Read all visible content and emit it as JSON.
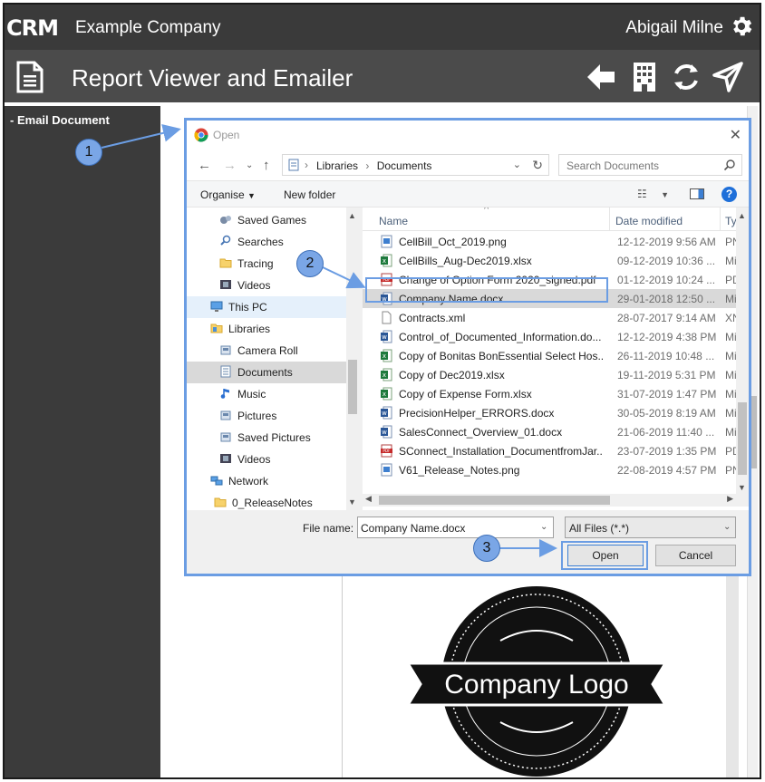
{
  "app": {
    "logo_text": "CRM",
    "company": "Example Company",
    "user": "Abigail Milne",
    "page_title": "Report Viewer and Emailer"
  },
  "sidebar": {
    "items": [
      {
        "label": "Email Document"
      }
    ]
  },
  "dialog": {
    "title": "Open",
    "address_path": [
      "Libraries",
      "Documents"
    ],
    "search_placeholder": "Search Documents",
    "toolbar": {
      "organise": "Organise",
      "new_folder": "New folder"
    },
    "nav_items": [
      {
        "label": "Saved Games",
        "icon": "saved-games-icon"
      },
      {
        "label": "Searches",
        "icon": "search-folder-icon"
      },
      {
        "label": "Tracing",
        "icon": "folder-icon"
      },
      {
        "label": "Videos",
        "icon": "videos-icon"
      },
      {
        "label": "This PC",
        "icon": "computer-icon"
      },
      {
        "label": "Libraries",
        "icon": "libraries-icon"
      },
      {
        "label": "Camera Roll",
        "icon": "library-icon"
      },
      {
        "label": "Documents",
        "icon": "documents-icon",
        "selected": true
      },
      {
        "label": "Music",
        "icon": "music-icon"
      },
      {
        "label": "Pictures",
        "icon": "library-icon"
      },
      {
        "label": "Saved Pictures",
        "icon": "library-icon"
      },
      {
        "label": "Videos",
        "icon": "videos-icon"
      },
      {
        "label": "Network",
        "icon": "network-icon"
      },
      {
        "label": "0_ReleaseNotes",
        "icon": "folder-icon"
      }
    ],
    "columns": {
      "name": "Name",
      "date": "Date modified",
      "type": "Typ"
    },
    "files": [
      {
        "name": "CellBill_Oct_2019.png",
        "date": "12-12-2019 9:56 AM",
        "type": "PN",
        "icon": "image-file-icon"
      },
      {
        "name": "CellBills_Aug-Dec2019.xlsx",
        "date": "09-12-2019 10:36 ...",
        "type": "Mi",
        "icon": "excel-file-icon"
      },
      {
        "name": "Change of Option Form 2020_signed.pdf",
        "date": "01-12-2019 10:24 ...",
        "type": "PD",
        "icon": "pdf-file-icon"
      },
      {
        "name": "Company Name.docx",
        "date": "29-01-2018 12:50 ...",
        "type": "Mi",
        "icon": "word-file-icon",
        "selected": true
      },
      {
        "name": "Contracts.xml",
        "date": "28-07-2017 9:14 AM",
        "type": "XN",
        "icon": "blank-file-icon"
      },
      {
        "name": "Control_of_Documented_Information.do...",
        "date": "12-12-2019 4:38 PM",
        "type": "Mi",
        "icon": "word-file-icon"
      },
      {
        "name": "Copy of Bonitas BonEssential Select Hos...",
        "date": "26-11-2019 10:48 ...",
        "type": "Mi",
        "icon": "excel-file-icon"
      },
      {
        "name": "Copy of Dec2019.xlsx",
        "date": "19-11-2019 5:31 PM",
        "type": "Mi",
        "icon": "excel-file-icon"
      },
      {
        "name": "Copy of Expense Form.xlsx",
        "date": "31-07-2019 1:47 PM",
        "type": "Mi",
        "icon": "excel-file-icon"
      },
      {
        "name": "PrecisionHelper_ERRORS.docx",
        "date": "30-05-2019 8:19 AM",
        "type": "Mi",
        "icon": "word-file-icon"
      },
      {
        "name": "SalesConnect_Overview_01.docx",
        "date": "21-06-2019 11:40 ...",
        "type": "Mi",
        "icon": "word-file-icon"
      },
      {
        "name": "SConnect_Installation_DocumentfromJar...",
        "date": "23-07-2019 1:35 PM",
        "type": "PD",
        "icon": "pdf-file-icon"
      },
      {
        "name": "V61_Release_Notes.png",
        "date": "22-08-2019 4:57 PM",
        "type": "PN",
        "icon": "image-file-icon"
      }
    ],
    "file_name_label": "File name:",
    "file_name_value": "Company Name.docx",
    "filter_value": "All Files (*.*)",
    "open_label": "Open",
    "cancel_label": "Cancel"
  },
  "callouts": [
    "1",
    "2",
    "3"
  ],
  "logo_image": {
    "text": "Company Logo"
  },
  "colors": {
    "accent": "#6b9de3",
    "topbar": "#3a3a3a",
    "sidebar": "#3b3b3b"
  }
}
